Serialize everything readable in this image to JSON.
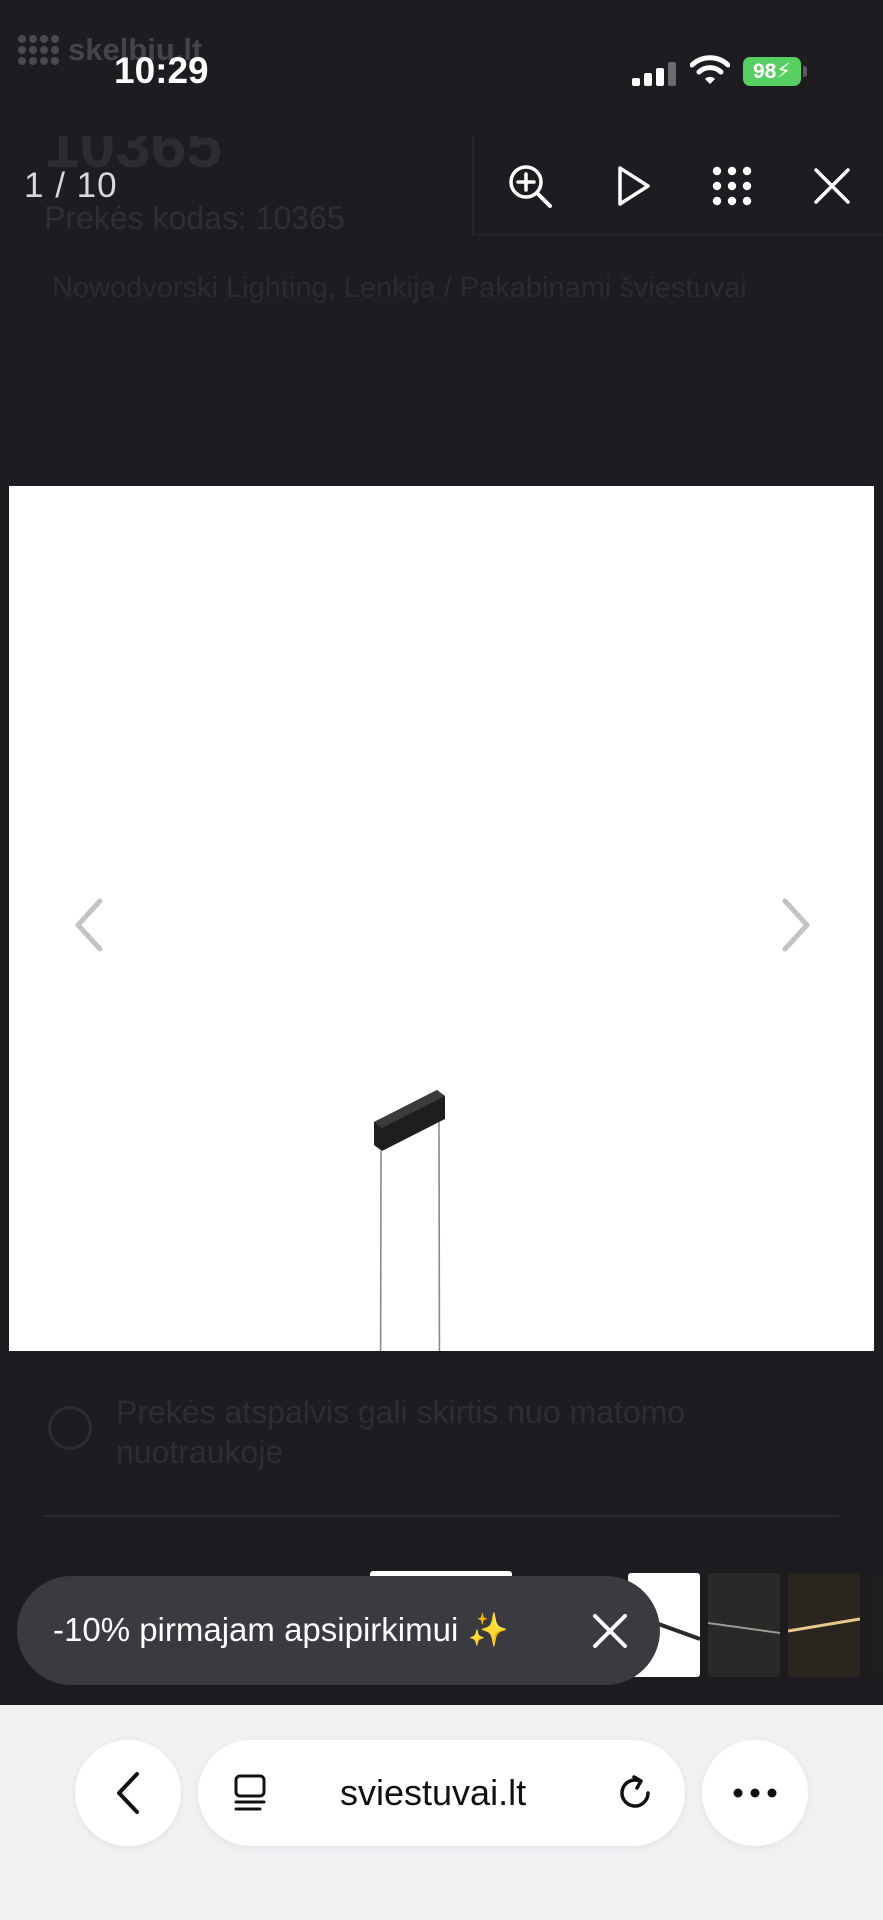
{
  "status_bar": {
    "time": "10:29",
    "battery": "98",
    "watermark": "skelbiu.lt"
  },
  "underlay": {
    "title": "10365",
    "product_code": "Prekės kodas: 10365",
    "breadcrumb": "Nowodvorski Lighting, Lenkija / Pakabinami šviestuvai",
    "note": "Prekės atspalvis gali skirtis nuo matomo nuotraukoje"
  },
  "viewer": {
    "counter": "1 / 10",
    "icons": [
      "zoom-in-icon",
      "play-icon",
      "grid-icon",
      "close-icon",
      "chevron-left-icon",
      "chevron-right-icon"
    ]
  },
  "promo": {
    "text": "-10% pirmajam apsipirkimui ✨"
  },
  "browser": {
    "url": "sviestuvai.lt",
    "icons": [
      "back-icon",
      "tabs-icon",
      "reload-icon",
      "more-icon"
    ]
  },
  "colors": {
    "background": "#1d1d22",
    "battery": "#58cf63",
    "toast": "#3a3a40",
    "browser_bar": "#f1f1f4"
  }
}
